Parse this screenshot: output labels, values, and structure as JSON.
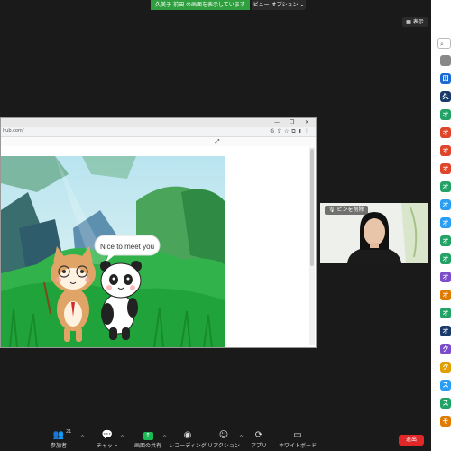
{
  "topbar": {
    "share_banner": "久美子 前田 の画面を表示しています",
    "view_options": "ビュー オプション ⌄",
    "display_label": "表示"
  },
  "browser": {
    "url": "hub.com/",
    "scene": {
      "speech_bubble": "Nice to meet you"
    }
  },
  "camera_tile": {
    "pin_label": "ピンを削除"
  },
  "sidebar": {
    "avatars": [
      {
        "letter": "",
        "color": "#888888"
      },
      {
        "letter": "田",
        "color": "#1a6bd1"
      },
      {
        "letter": "久",
        "color": "#1a3a6b"
      },
      {
        "letter": "オ",
        "color": "#21a366"
      },
      {
        "letter": "オ",
        "color": "#e0452b"
      },
      {
        "letter": "オ",
        "color": "#e0452b"
      },
      {
        "letter": "オ",
        "color": "#e0452b"
      },
      {
        "letter": "オ",
        "color": "#21a366"
      },
      {
        "letter": "オ",
        "color": "#2a9df4"
      },
      {
        "letter": "オ",
        "color": "#2a9df4"
      },
      {
        "letter": "オ",
        "color": "#21a366"
      },
      {
        "letter": "オ",
        "color": "#21a366"
      },
      {
        "letter": "オ",
        "color": "#7b4dcc"
      },
      {
        "letter": "オ",
        "color": "#e07b00"
      },
      {
        "letter": "オ",
        "color": "#21a366"
      },
      {
        "letter": "オ",
        "color": "#1a3a6b"
      },
      {
        "letter": "ク",
        "color": "#7b4dcc"
      },
      {
        "letter": "ク",
        "color": "#e0a000"
      },
      {
        "letter": "ス",
        "color": "#2a9df4"
      },
      {
        "letter": "ス",
        "color": "#21a366"
      },
      {
        "letter": "そ",
        "color": "#e07b00"
      }
    ]
  },
  "toolbar": {
    "participants_label": "参加者",
    "participants_count": "21",
    "chat_label": "チャット",
    "share_label": "画面の共有",
    "record_label": "レコーディング",
    "reaction_label": "リアクション",
    "apps_label": "アプリ",
    "whiteboard_label": "ホワイトボード",
    "leave_label": "退出"
  },
  "colors": {
    "background": "#1a1a1a",
    "share_green": "#2e9e3e",
    "leave_red": "#e02828"
  }
}
